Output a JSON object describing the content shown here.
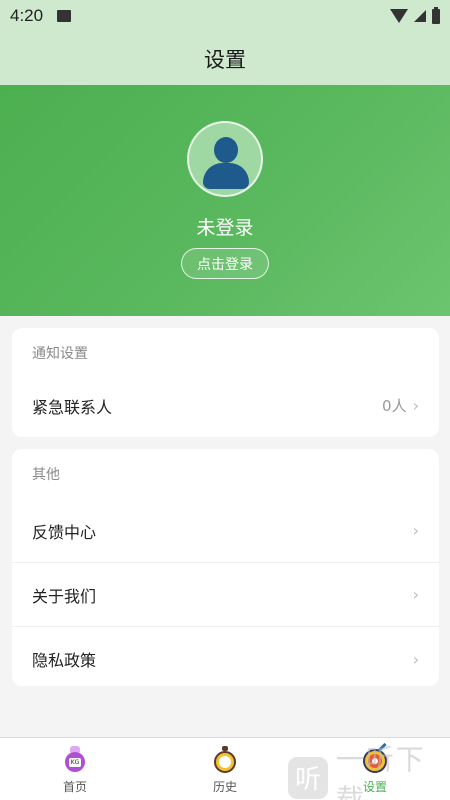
{
  "status_bar": {
    "time": "4:20"
  },
  "header": {
    "title": "设置"
  },
  "profile": {
    "login_status": "未登录",
    "login_button": "点击登录"
  },
  "notify_section": {
    "title": "通知设置",
    "items": [
      {
        "label": "紧急联系人",
        "value": "0人"
      }
    ]
  },
  "other_section": {
    "title": "其他",
    "items": [
      {
        "label": "反馈中心"
      },
      {
        "label": "关于我们"
      },
      {
        "label": "隐私政策"
      }
    ]
  },
  "bottom_nav": {
    "items": [
      {
        "label": "首页",
        "icon": "kettlebell-icon",
        "active": false
      },
      {
        "label": "历史",
        "icon": "stopwatch-icon",
        "active": false
      },
      {
        "label": "设置",
        "icon": "target-icon",
        "active": true
      }
    ]
  },
  "watermark": {
    "logo": "听",
    "text": "一听下载"
  },
  "colors": {
    "accent": "#4caf50",
    "header_bg": "#cfe9cf",
    "page_bg": "#f4f4f4"
  },
  "chevron": "›"
}
